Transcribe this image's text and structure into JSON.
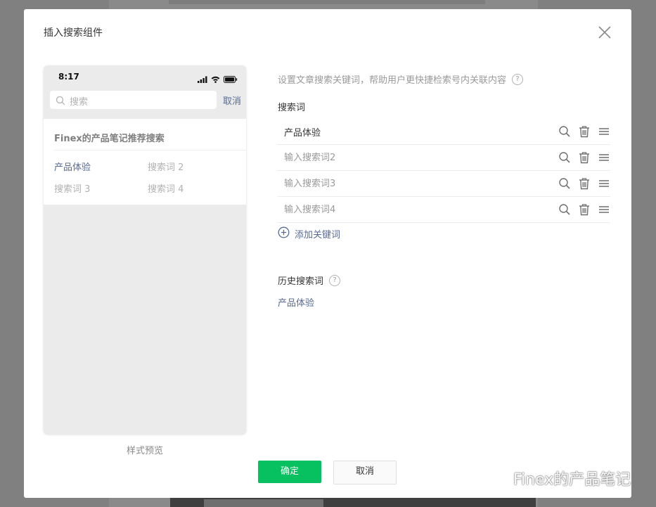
{
  "dialog": {
    "title": "插入搜索组件",
    "close_icon": "close-icon"
  },
  "preview": {
    "status_time": "8:17",
    "search_placeholder": "搜索",
    "cancel_label": "取消",
    "recommend_title": "Finex的产品笔记推荐搜索",
    "recommend_items": [
      "产品体验",
      "搜索词 2",
      "搜索词 3",
      "搜索词 4"
    ],
    "caption": "样式预览"
  },
  "settings": {
    "description": "设置文章搜索关键词，帮助用户更快捷检索号内关联内容",
    "help_symbol": "?",
    "keywords_label": "搜索词",
    "keywords": [
      {
        "value": "产品体验",
        "placeholder": ""
      },
      {
        "value": "",
        "placeholder": "输入搜索词2"
      },
      {
        "value": "",
        "placeholder": "输入搜索词3"
      },
      {
        "value": "",
        "placeholder": "输入搜索词4"
      }
    ],
    "add_keyword_label": "添加关键词",
    "history_label": "历史搜索词",
    "history_items": [
      "产品体验"
    ]
  },
  "footer": {
    "ok_label": "确定",
    "cancel_label": "取消"
  },
  "watermark": {
    "text": "Finex的产品笔记"
  },
  "colors": {
    "accent_green": "#07c160",
    "link_blue": "#576b95",
    "overlay": "#808080"
  }
}
